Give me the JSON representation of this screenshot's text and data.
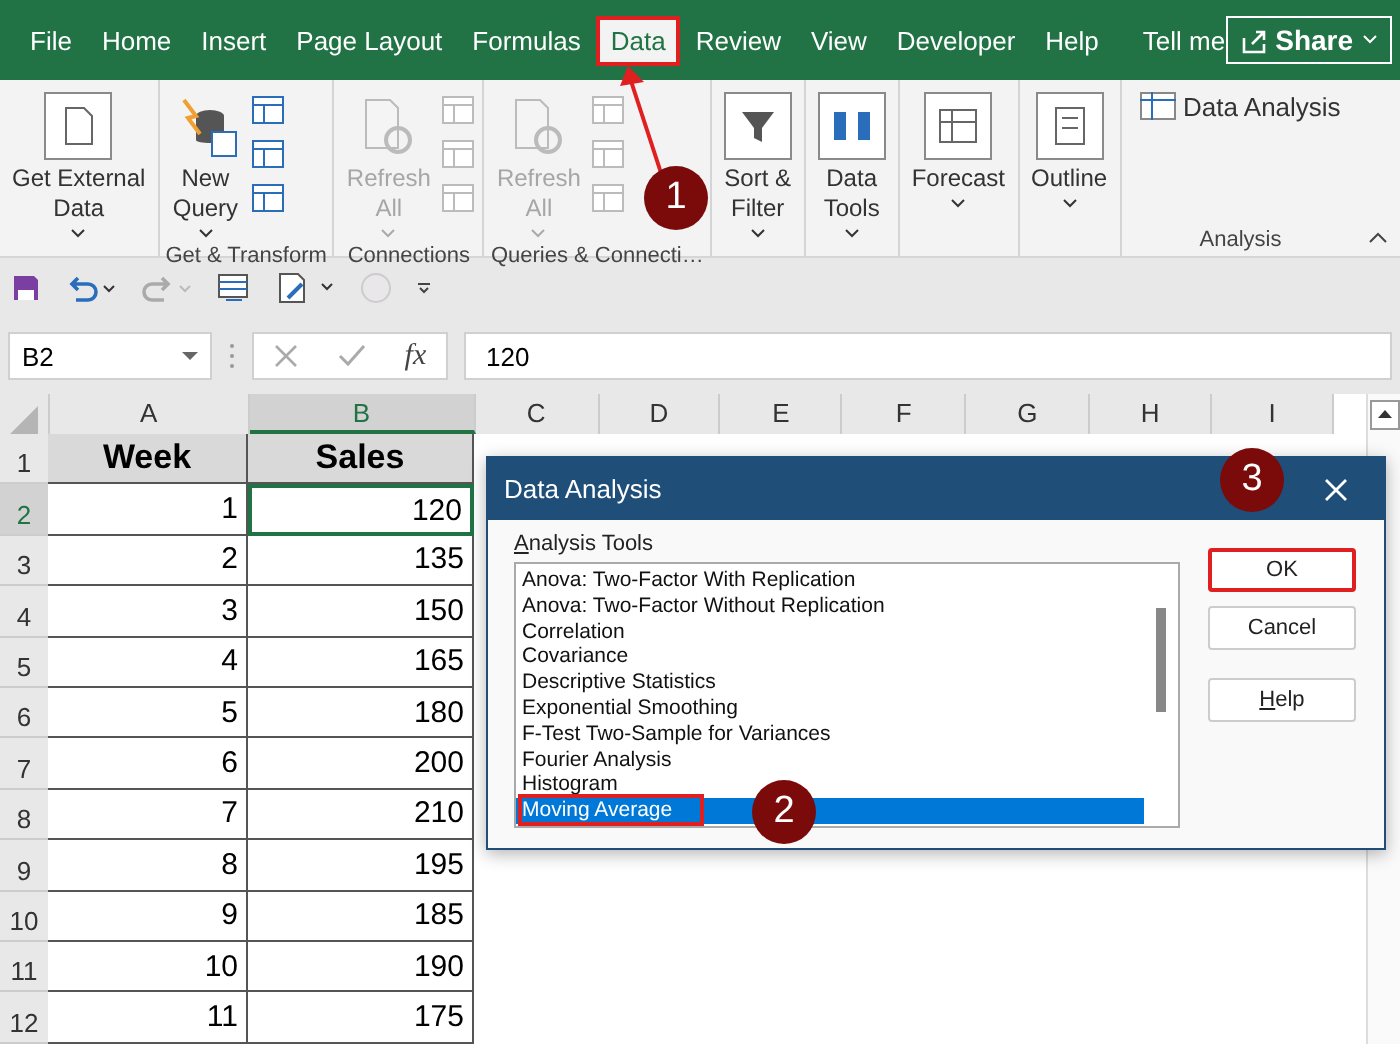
{
  "menu_tabs": [
    {
      "label": "File",
      "selected": false,
      "highlighted": false
    },
    {
      "label": "Home",
      "selected": false,
      "highlighted": false
    },
    {
      "label": "Insert",
      "selected": false,
      "highlighted": false
    },
    {
      "label": "Page Layout",
      "selected": false,
      "highlighted": false
    },
    {
      "label": "Formulas",
      "selected": false,
      "highlighted": false
    },
    {
      "label": "Data",
      "selected": true,
      "highlighted": true
    },
    {
      "label": "Review",
      "selected": false,
      "highlighted": false
    },
    {
      "label": "View",
      "selected": false,
      "highlighted": false
    },
    {
      "label": "Developer",
      "selected": false,
      "highlighted": false
    },
    {
      "label": "Help",
      "selected": false,
      "highlighted": false
    }
  ],
  "tell_me": "Tell me",
  "share": "Share",
  "ribbon_groups": [
    {
      "buttons": [
        {
          "lines": [
            "Get External",
            "Data"
          ],
          "dropdown": true,
          "disabled": false
        }
      ]
    },
    {
      "label": "Get & Transform",
      "buttons": [
        {
          "lines": [
            "New",
            "Query"
          ],
          "dropdown": true,
          "disabled": false
        }
      ]
    },
    {
      "label": "Connections",
      "buttons": [
        {
          "lines": [
            "Refresh",
            "All"
          ],
          "dropdown": true,
          "disabled": true
        }
      ]
    },
    {
      "label": "Queries & Connecti…",
      "buttons": [
        {
          "lines": [
            "Refresh",
            "All"
          ],
          "dropdown": true,
          "disabled": true
        }
      ]
    },
    {
      "buttons": [
        {
          "lines": [
            "Sort &",
            "Filter"
          ],
          "dropdown": true,
          "disabled": false
        }
      ]
    },
    {
      "buttons": [
        {
          "lines": [
            "Data",
            "Tools"
          ],
          "dropdown": true,
          "disabled": false
        }
      ]
    },
    {
      "buttons": [
        {
          "lines": [
            "Forecast"
          ],
          "dropdown": true,
          "disabled": false
        }
      ]
    },
    {
      "buttons": [
        {
          "lines": [
            "Outline"
          ],
          "dropdown": true,
          "disabled": false
        }
      ]
    },
    {
      "label": "Analysis",
      "buttons": [
        {
          "lines": [
            "Data Analysis"
          ],
          "dropdown": false,
          "disabled": false
        }
      ]
    }
  ],
  "name_box": "B2",
  "function_label": "fx",
  "formula": "120",
  "columns": [
    {
      "label": "A",
      "selected": false
    },
    {
      "label": "B",
      "selected": true
    },
    {
      "label": "C",
      "selected": false
    },
    {
      "label": "D",
      "selected": false
    },
    {
      "label": "E",
      "selected": false
    },
    {
      "label": "F",
      "selected": false
    },
    {
      "label": "G",
      "selected": false
    },
    {
      "label": "H",
      "selected": false
    },
    {
      "label": "I",
      "selected": false
    }
  ],
  "rows": [
    {
      "number": "1",
      "selected": false,
      "kind": "header",
      "cells": [
        "Week",
        "Sales"
      ]
    },
    {
      "number": "2",
      "selected": true,
      "kind": "data",
      "cells": [
        "1",
        "120"
      ]
    },
    {
      "number": "3",
      "selected": false,
      "kind": "data",
      "cells": [
        "2",
        "135"
      ]
    },
    {
      "number": "4",
      "selected": false,
      "kind": "data",
      "cells": [
        "3",
        "150"
      ]
    },
    {
      "number": "5",
      "selected": false,
      "kind": "data",
      "cells": [
        "4",
        "165"
      ]
    },
    {
      "number": "6",
      "selected": false,
      "kind": "data",
      "cells": [
        "5",
        "180"
      ]
    },
    {
      "number": "7",
      "selected": false,
      "kind": "data",
      "cells": [
        "6",
        "200"
      ]
    },
    {
      "number": "8",
      "selected": false,
      "kind": "data",
      "cells": [
        "7",
        "210"
      ]
    },
    {
      "number": "9",
      "selected": false,
      "kind": "data",
      "cells": [
        "8",
        "195"
      ]
    },
    {
      "number": "10",
      "selected": false,
      "kind": "data",
      "cells": [
        "9",
        "185"
      ]
    },
    {
      "number": "11",
      "selected": false,
      "kind": "data",
      "cells": [
        "10",
        "190"
      ]
    },
    {
      "number": "12",
      "selected": false,
      "kind": "data",
      "cells": [
        "11",
        "175"
      ]
    }
  ],
  "dialog": {
    "title": "Data Analysis",
    "list_label": "Analysis Tools",
    "tools": [
      {
        "label": "Anova: Two-Factor With Replication",
        "selected": false,
        "highlighted": false
      },
      {
        "label": "Anova: Two-Factor Without Replication",
        "selected": false,
        "highlighted": false
      },
      {
        "label": "Correlation",
        "selected": false,
        "highlighted": false
      },
      {
        "label": "Covariance",
        "selected": false,
        "highlighted": false
      },
      {
        "label": "Descriptive Statistics",
        "selected": false,
        "highlighted": false
      },
      {
        "label": "Exponential Smoothing",
        "selected": false,
        "highlighted": false
      },
      {
        "label": "F-Test Two-Sample for Variances",
        "selected": false,
        "highlighted": false
      },
      {
        "label": "Fourier Analysis",
        "selected": false,
        "highlighted": false
      },
      {
        "label": "Histogram",
        "selected": false,
        "highlighted": false
      },
      {
        "label": "Moving Average",
        "selected": true,
        "highlighted": true
      }
    ],
    "buttons": [
      {
        "label": "OK",
        "highlighted": true
      },
      {
        "label": "Cancel",
        "highlighted": false
      },
      {
        "label": "Help",
        "highlighted": false
      }
    ]
  },
  "callouts": [
    {
      "label": "1"
    },
    {
      "label": "2"
    },
    {
      "label": "3"
    }
  ]
}
